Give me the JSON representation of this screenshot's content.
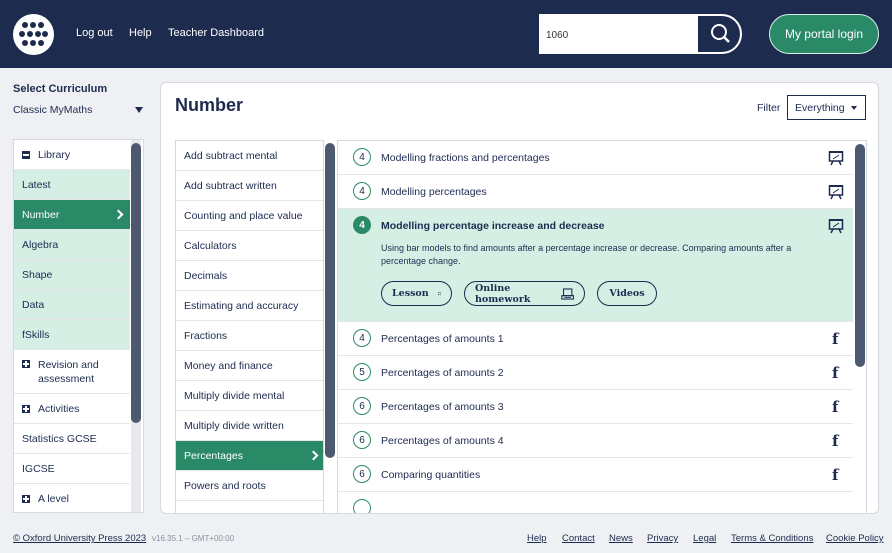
{
  "header": {
    "nav": [
      "Log out",
      "Help",
      "Teacher Dashboard"
    ],
    "search_value": "1060",
    "portal_label": "My portal login"
  },
  "sidebar": {
    "title": "Select Curriculum",
    "curriculum": "Classic MyMaths",
    "items": [
      {
        "label": "Library",
        "type": "minus"
      },
      {
        "label": "Latest",
        "type": "sub"
      },
      {
        "label": "Number",
        "type": "active"
      },
      {
        "label": "Algebra",
        "type": "sub"
      },
      {
        "label": "Shape",
        "type": "sub"
      },
      {
        "label": "Data",
        "type": "sub"
      },
      {
        "label": "fSkills",
        "type": "sub"
      },
      {
        "label": "Revision and assessment",
        "type": "plus"
      },
      {
        "label": "Activities",
        "type": "plus"
      },
      {
        "label": "Statistics GCSE",
        "type": "plain"
      },
      {
        "label": "IGCSE",
        "type": "plain"
      },
      {
        "label": "A level",
        "type": "plus"
      }
    ]
  },
  "main": {
    "title": "Number",
    "filter_label": "Filter",
    "filter_value": "Everything",
    "topics": [
      "Add subtract mental",
      "Add subtract written",
      "Counting and place value",
      "Calculators",
      "Decimals",
      "Estimating and accuracy",
      "Fractions",
      "Money and finance",
      "Multiply divide mental",
      "Multiply divide written",
      "Percentages",
      "Powers and roots"
    ],
    "active_topic": "Percentages",
    "lessons": [
      {
        "level": "4",
        "title": "Modelling fractions and percentages",
        "icon": "presentation-icon"
      },
      {
        "level": "4",
        "title": "Modelling percentages",
        "icon": "presentation-icon"
      },
      {
        "level": "4",
        "title": "Modelling percentage increase and decrease",
        "icon": "presentation-icon",
        "expanded": true,
        "description": "Using bar models to find amounts after a percentage increase or decrease. Comparing amounts after a percentage change.",
        "buttons": [
          "Lesson",
          "Online homework",
          "Videos"
        ]
      },
      {
        "level": "4",
        "title": "Percentages of amounts 1",
        "icon": "f"
      },
      {
        "level": "5",
        "title": "Percentages of amounts 2",
        "icon": "f"
      },
      {
        "level": "6",
        "title": "Percentages of amounts 3",
        "icon": "f"
      },
      {
        "level": "6",
        "title": "Percentages of amounts 4",
        "icon": "f"
      },
      {
        "level": "6",
        "title": "Comparing quantities",
        "icon": "f"
      }
    ]
  },
  "footer": {
    "copyright": "© Oxford University Press 2023",
    "version": "v16.35.1 – GMT+00:00",
    "links": [
      "Help",
      "Contact",
      "News",
      "Privacy",
      "Legal",
      "Terms & Conditions",
      "Cookie Policy"
    ]
  },
  "colors": {
    "navy": "#1d2b4f",
    "green": "#2a8a67",
    "light_green": "#d6efe5"
  }
}
